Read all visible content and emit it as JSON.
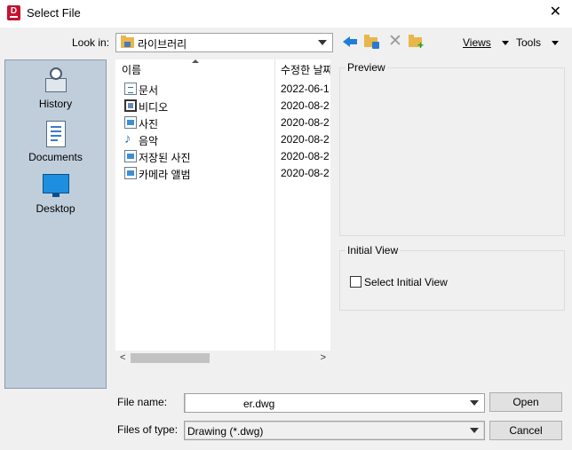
{
  "window": {
    "title": "Select File",
    "app_icon_letter": "D"
  },
  "toolbar": {
    "look_in_label": "Look in:",
    "look_in_value": "라이브러리",
    "views_label": "Views",
    "tools_label": "Tools"
  },
  "places": [
    {
      "label": "History"
    },
    {
      "label": "Documents"
    },
    {
      "label": "Desktop"
    }
  ],
  "file_list": {
    "columns": {
      "name": "이름",
      "date": "수정한 날짜"
    },
    "rows": [
      {
        "name": "문서",
        "date": "2022-06-1",
        "icon": "document-icon"
      },
      {
        "name": "비디오",
        "date": "2020-08-2",
        "icon": "video-icon"
      },
      {
        "name": "사진",
        "date": "2020-08-2",
        "icon": "picture-icon"
      },
      {
        "name": "음악",
        "date": "2020-08-2",
        "icon": "music-icon"
      },
      {
        "name": "저장된 사진",
        "date": "2020-08-2",
        "icon": "picture-icon"
      },
      {
        "name": "카메라 앨범",
        "date": "2020-08-2",
        "icon": "picture-icon"
      }
    ]
  },
  "preview": {
    "title": "Preview"
  },
  "initial_view": {
    "title": "Initial View",
    "checkbox_label": "Select Initial View",
    "checked": false
  },
  "form": {
    "file_name_label": "File name:",
    "file_name_value": "er.dwg",
    "files_of_type_label": "Files of type:",
    "files_of_type_value": "Drawing (*.dwg)"
  },
  "buttons": {
    "open": "Open",
    "cancel": "Cancel"
  }
}
